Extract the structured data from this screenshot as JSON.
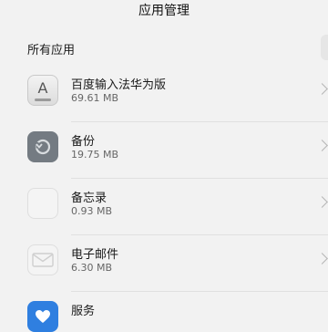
{
  "header": {
    "title": "应用管理"
  },
  "section": {
    "label": "所有应用"
  },
  "apps": [
    {
      "name": "百度输入法华为版",
      "size": "69.61 MB",
      "icon": "keyboard-icon",
      "icon_glyph": "A"
    },
    {
      "name": "备份",
      "size": "19.75 MB",
      "icon": "backup-icon"
    },
    {
      "name": "备忘录",
      "size": "0.93 MB",
      "icon": "notes-icon"
    },
    {
      "name": "电子邮件",
      "size": "6.30 MB",
      "icon": "mail-icon"
    },
    {
      "name": "服务",
      "size": "",
      "icon": "service-icon"
    }
  ],
  "colors": {
    "background": "#f2f2f2",
    "backup_icon": "#747b82",
    "service_icon": "#2f7fe0"
  }
}
